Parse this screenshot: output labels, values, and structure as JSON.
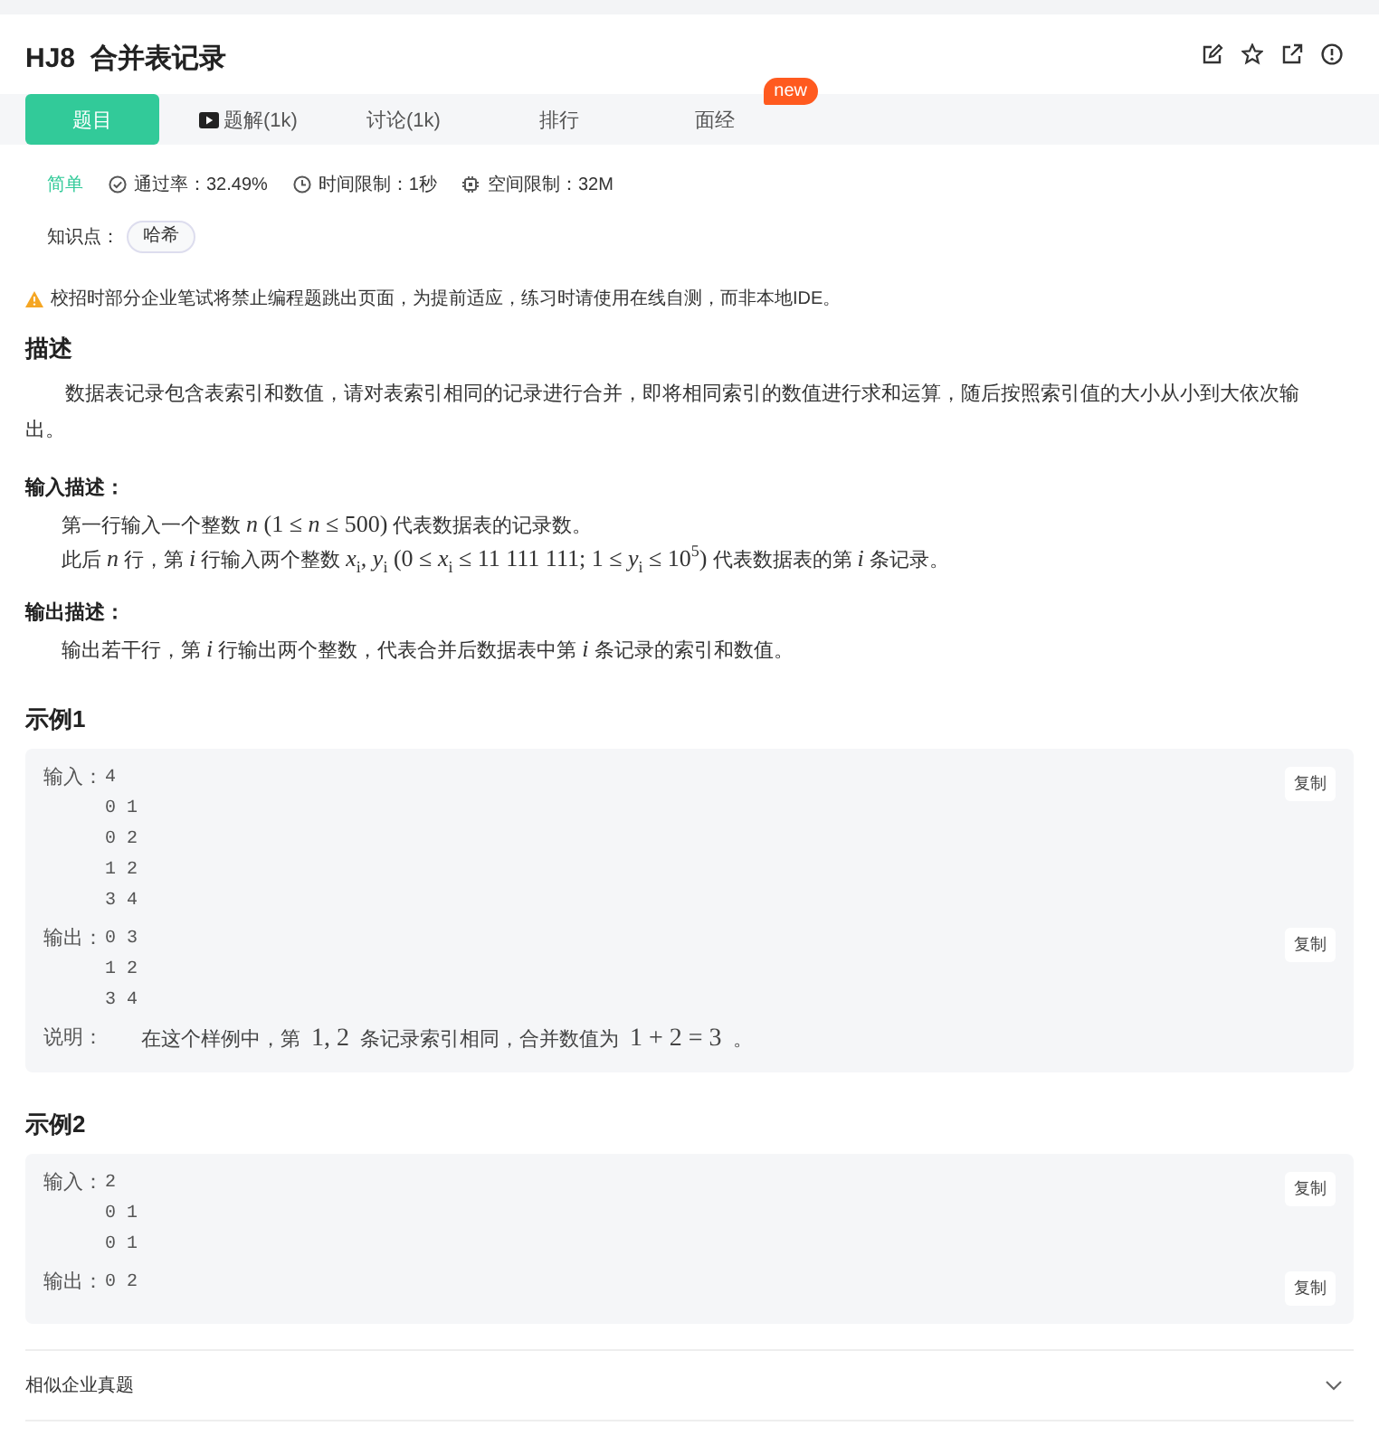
{
  "problem": {
    "code": "HJ8",
    "title": "合并表记录"
  },
  "tabs": [
    {
      "label": "题目",
      "selected": true,
      "kind": "plain"
    },
    {
      "label": "题解(1k)",
      "selected": false,
      "kind": "video"
    },
    {
      "label": "讨论(1k)",
      "selected": false,
      "kind": "plain"
    },
    {
      "label": "排行",
      "selected": false,
      "kind": "plain"
    },
    {
      "label": "面经",
      "selected": false,
      "kind": "plain",
      "badge": "new"
    }
  ],
  "meta": {
    "difficulty": "简单",
    "pass_rate": "通过率：32.49%",
    "time_limit": "时间限制：1秒",
    "memory_limit": "空间限制：32M"
  },
  "knowledge": {
    "label": "知识点：",
    "tags": [
      "哈希"
    ]
  },
  "notice": "校招时部分企业笔试将禁止编程题跳出页面，为提前适应，练习时请使用在线自测，而非本地IDE。",
  "description": {
    "heading": "描述",
    "text": "数据表记录包含表索引和数值，请对表索引相同的记录进行合并，即将相同索引的数值进行求和运算，随后按照索引值的大小从小到大依次输出。"
  },
  "input_desc": {
    "heading": "输入描述：",
    "lines": [
      [
        {
          "kind": "text",
          "text": "第一行输入一个整数"
        },
        {
          "kind": "math",
          "text": "*n* (1 ≤ *n* ≤ 500)"
        },
        {
          "kind": "text",
          "text": "代表数据表的记录数。"
        }
      ],
      [
        {
          "kind": "text",
          "text": "此后"
        },
        {
          "kind": "math",
          "text": "*n*"
        },
        {
          "kind": "text",
          "text": "行，第"
        },
        {
          "kind": "math",
          "text": "*i*"
        },
        {
          "kind": "text",
          "text": "行输入两个整数"
        },
        {
          "kind": "math",
          "text": "*x*$_{i}$, *y*$_{i}$ (0 ≤ *x*$_{i}$ ≤ 11 111 111; 1 ≤ *y*$_{i}$ ≤ 10$^{5}$)"
        },
        {
          "kind": "text",
          "text": "代表数据表的第"
        },
        {
          "kind": "math",
          "text": "*i*"
        },
        {
          "kind": "text",
          "text": "条记录。"
        }
      ]
    ]
  },
  "output_desc": {
    "heading": "输出描述：",
    "lines": [
      [
        {
          "kind": "text",
          "text": "输出若干行，第"
        },
        {
          "kind": "math",
          "text": "*i*"
        },
        {
          "kind": "text",
          "text": "行输出两个整数，代表合并后数据表中第"
        },
        {
          "kind": "math",
          "text": "*i*"
        },
        {
          "kind": "text",
          "text": "条记录的索引和数值。"
        }
      ]
    ]
  },
  "examples": [
    {
      "heading": "示例1",
      "input_label": "输入：",
      "input": [
        "4",
        "0 1",
        "0 2",
        "1 2",
        "3 4"
      ],
      "output_label": "输出：",
      "output": [
        "0 3",
        "1 2",
        "3 4"
      ],
      "input_copy": "复制",
      "output_copy": "复制",
      "explain_label": "说明：",
      "explain": [
        {
          "kind": "text",
          "text": "在这个样例中，第"
        },
        {
          "kind": "math",
          "text": "1, 2"
        },
        {
          "kind": "text",
          "text": "条记录索引相同，合并数值为"
        },
        {
          "kind": "math",
          "text": "1 + 2 = 3"
        },
        {
          "kind": "text",
          "text": "。"
        }
      ]
    },
    {
      "heading": "示例2",
      "input_label": "输入：",
      "input": [
        "2",
        "0 1",
        "0 1"
      ],
      "output_label": "输出：",
      "output": [
        "0 2"
      ],
      "input_copy": "复制",
      "output_copy": "复制"
    }
  ],
  "similar": {
    "label": "相似企业真题",
    "expanded": false
  }
}
